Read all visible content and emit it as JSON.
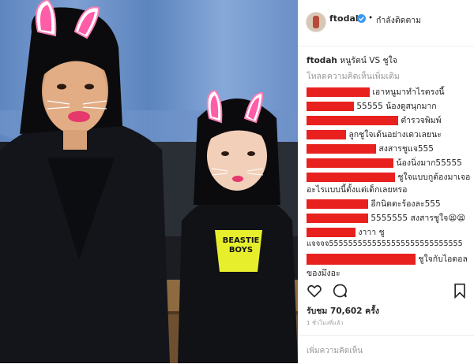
{
  "post": {
    "photo": {
      "shirt_logo_line1": "BEASTIE",
      "shirt_logo_line2": "BOYS"
    }
  },
  "header": {
    "username": "ftodah",
    "verified_icon": "verified-badge-icon",
    "separator": "•",
    "follow_status": "กำลังติดตาม"
  },
  "caption": {
    "username": "ftodah",
    "text": "หนูรัตน์ VS ชูใจ"
  },
  "load_more": "โหลดความคิดเห็นเพิ่มเติม",
  "comments": [
    {
      "text": "เอาหนูมาทำไรตรงนี้"
    },
    {
      "text": "55555 น้องดูสนุกมาก"
    },
    {
      "text": "ตำรวจพิมพ์"
    },
    {
      "text": "ลูกชูใจเด้นอย่างเดวเลยนะ"
    },
    {
      "text": "สงสารชูแจ555"
    },
    {
      "text": "น้องนิ่งมาก55555"
    },
    {
      "text": "ชูใจแบบกูต้องมาเจอ"
    },
    {
      "text": "อะไรแบบนี้ตั้งแต่เด็กเลยหรอ"
    },
    {
      "text": "อีกนิดตะร้องละ555"
    },
    {
      "text": "5555555 สงสารชูใจ😫😫"
    },
    {
      "text": "งาาา ชู"
    },
    {
      "text": "แจจจจ5555555555555555555555555555"
    },
    {
      "text": "ชูใจกับไอดอล"
    },
    {
      "text": "ของมึงอะ"
    }
  ],
  "actions": {
    "like_icon": "heart-icon",
    "comment_icon": "comment-icon",
    "save_icon": "bookmark-icon"
  },
  "likes": {
    "label": "รับชม 70,602 ครั้ง"
  },
  "timestamp": "1 ชั่วโมงที่แล้ว",
  "add_comment": {
    "placeholder": "เพิ่มความคิดเห็น"
  },
  "colors": {
    "redaction": "#e8211e",
    "verified": "#3897f0",
    "muted": "#999999"
  }
}
